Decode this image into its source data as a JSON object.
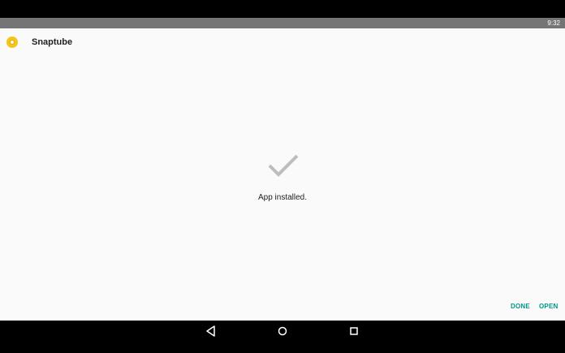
{
  "status_bar": {
    "time": "9:32"
  },
  "app": {
    "name": "Snaptube",
    "icon": "snaptube-icon"
  },
  "installer": {
    "status_icon": "checkmark-icon",
    "message": "App installed."
  },
  "actions": {
    "done_label": "DONE",
    "open_label": "OPEN"
  },
  "navigation": {
    "back_icon": "back-icon",
    "home_icon": "home-icon",
    "recents_icon": "recents-icon"
  },
  "colors": {
    "accent": "#009688",
    "status_bar": "#757575",
    "background": "#fafafa",
    "app_icon": "#f5c518",
    "check": "#bdbdbd"
  }
}
